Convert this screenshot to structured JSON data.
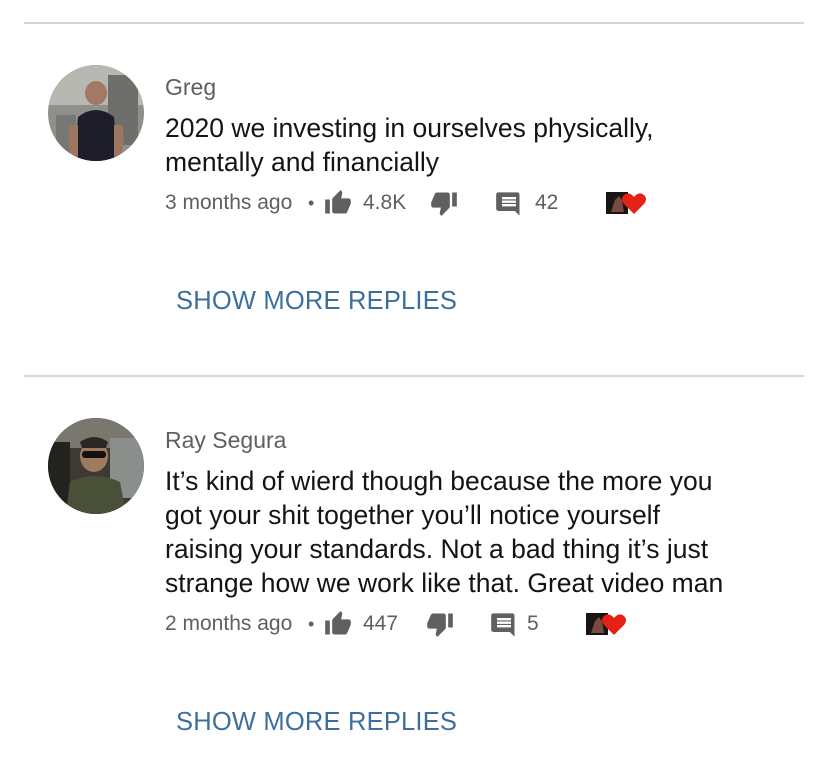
{
  "comments": [
    {
      "author": "Greg",
      "text_line1": "2020 we investing in ourselves physically,",
      "text_line2": "mentally and financially",
      "text_line3": "",
      "text_line4": "",
      "time": "3 months ago",
      "dot": "•",
      "likes": "4.8K",
      "replies": "42",
      "show_more_label": "SHOW MORE REPLIES",
      "icons": [
        "thumb-up-icon",
        "thumb-down-icon",
        "reply-icon",
        "creator-heart-icon"
      ]
    },
    {
      "author": "Ray Segura",
      "text_line1": "It’s kind of wierd though because the more you",
      "text_line2": "got your shit together you’ll notice yourself",
      "text_line3": "raising your standards. Not a bad thing it’s just",
      "text_line4": "strange how we work like that. Great video man",
      "time": "2 months ago",
      "dot": "•",
      "likes": "447",
      "replies": "5",
      "show_more_label": "SHOW MORE REPLIES",
      "icons": [
        "thumb-up-icon",
        "thumb-down-icon",
        "reply-icon",
        "creator-heart-icon"
      ]
    }
  ],
  "colors": {
    "link": "#3c6e9e",
    "meta": "#5f5f5f",
    "icon": "#606060",
    "heart": "#e62117",
    "divider": "#d6d6d6"
  }
}
